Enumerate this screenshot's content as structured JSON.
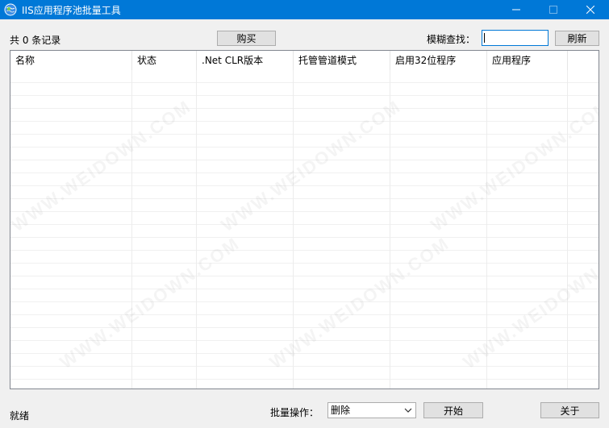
{
  "window": {
    "title": "IIS应用程序池批量工具",
    "accent_color": "#0078d7",
    "icons": {
      "app": "globe-icon",
      "minimize": "minimize-icon",
      "maximize": "maximize-icon",
      "close": "close-icon"
    }
  },
  "toolbar": {
    "record_count": "共 0 条记录",
    "buy_label": "购买",
    "search_label": "模糊查找：",
    "search_value": "",
    "refresh_label": "刷新"
  },
  "table": {
    "columns": [
      "名称",
      "状态",
      ".Net CLR版本",
      "托管管道模式",
      "启用32位程序",
      "应用程序"
    ],
    "rows": []
  },
  "watermark": "WWW.WEIDOWN.COM",
  "footer": {
    "status": "就绪",
    "batch_label": "批量操作：",
    "batch_selected": "删除",
    "start_label": "开始",
    "about_label": "关于"
  }
}
